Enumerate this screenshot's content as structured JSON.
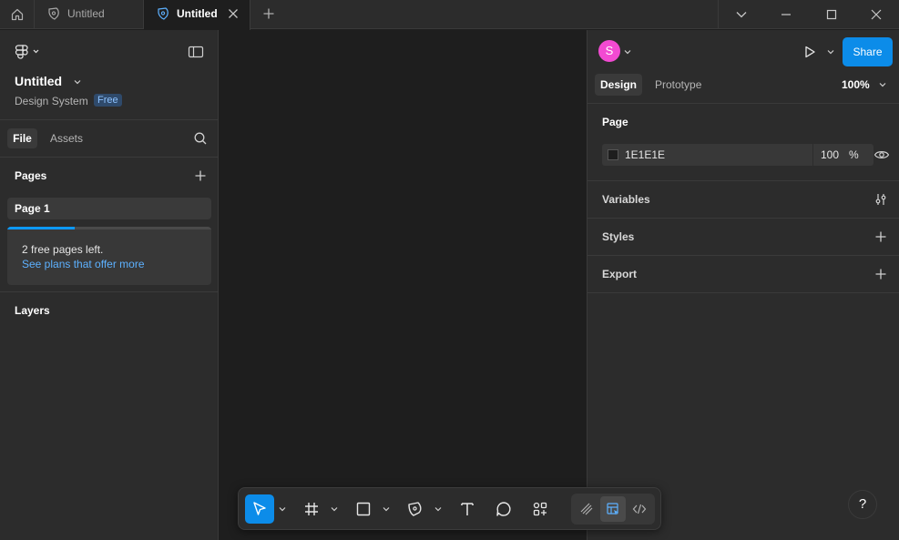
{
  "titlebar": {
    "tabs": [
      {
        "label": "Untitled",
        "active": false
      },
      {
        "label": "Untitled",
        "active": true
      }
    ]
  },
  "left_panel": {
    "file_name": "Untitled",
    "project": "Design System",
    "plan_badge": "Free",
    "tabs": {
      "file": "File",
      "assets": "Assets"
    },
    "pages_heading": "Pages",
    "pages": [
      {
        "label": "Page 1"
      }
    ],
    "notice": {
      "text": "2 free pages left.",
      "link": "See plans that offer more",
      "progress_fraction": 0.33
    },
    "layers_heading": "Layers"
  },
  "right_panel": {
    "avatar_initial": "S",
    "share_label": "Share",
    "tabs": {
      "design": "Design",
      "prototype": "Prototype"
    },
    "zoom": "100%",
    "page_section": {
      "heading": "Page",
      "color_hex": "1E1E1E",
      "opacity": "100",
      "opacity_unit": "%"
    },
    "sections": {
      "variables": "Variables",
      "styles": "Styles",
      "export": "Export"
    }
  },
  "help_label": "?",
  "colors": {
    "accent": "#0c8ce9",
    "avatar": "#f24ad2",
    "canvas_bg": "#1e1e1e",
    "panel_bg": "#2c2c2c"
  }
}
